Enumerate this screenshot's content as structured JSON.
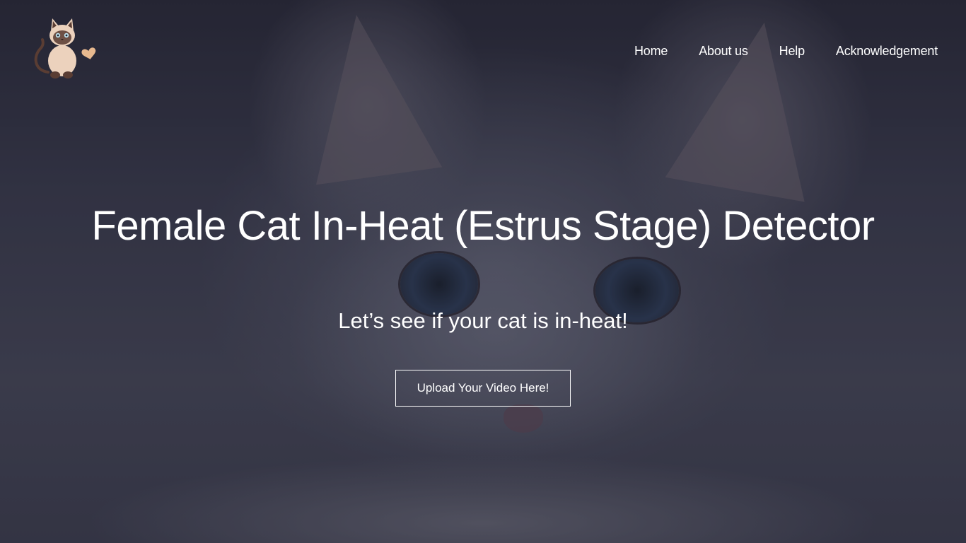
{
  "nav": {
    "items": [
      {
        "label": "Home"
      },
      {
        "label": "About us"
      },
      {
        "label": "Help"
      },
      {
        "label": "Acknowledgement"
      }
    ]
  },
  "hero": {
    "title": "Female Cat In-Heat (Estrus Stage) Detector",
    "subtitle": "Let’s see if your cat is in-heat!",
    "upload_button_label": "Upload Your Video Here!"
  },
  "logo": {
    "icon": "siamese-cat-with-heart-icon"
  },
  "colors": {
    "text": "#ffffff",
    "overlay": "#3d3e50",
    "logo_cat_body": "#ecd2bd",
    "logo_cat_points": "#5a3d33",
    "logo_heart": "#e8b98f"
  }
}
